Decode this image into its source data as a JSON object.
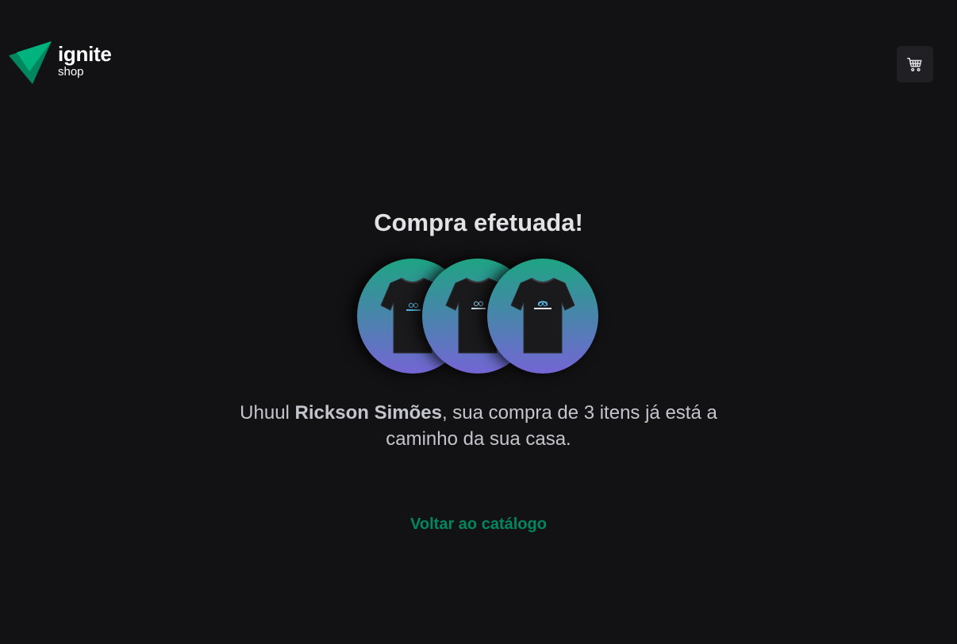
{
  "header": {
    "logo": {
      "title": "ignite",
      "subtitle": "shop",
      "icon": "triangle-logo-icon"
    },
    "cart_button": {
      "icon": "cart-icon"
    }
  },
  "main": {
    "title": "Compra efetuada!",
    "products": [
      {
        "icon": "t-shirt-icon"
      },
      {
        "icon": "t-shirt-icon"
      },
      {
        "icon": "t-shirt-icon"
      }
    ],
    "message": {
      "prefix": "Uhuul ",
      "customer_name": "Rickson Simões",
      "suffix": ", sua compra de 3 itens já está a caminho da sua casa."
    },
    "back_link": "Voltar ao catálogo"
  },
  "colors": {
    "background": "#121214",
    "brand_green": "#00875f",
    "gradient_top": "#1ea483",
    "gradient_bottom": "#7465d4",
    "cart_bg": "#202024"
  }
}
